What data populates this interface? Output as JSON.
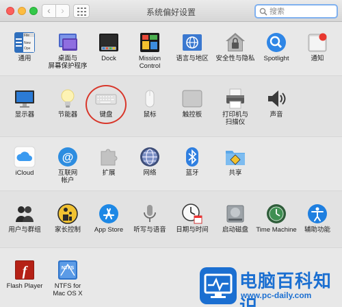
{
  "window": {
    "title": "系统偏好设置",
    "search_placeholder": "搜索",
    "back_glyph": "‹",
    "forward_glyph": "›"
  },
  "rows": [
    [
      {
        "id": "general",
        "label": "通用",
        "icon": "general-icon"
      },
      {
        "id": "desktop",
        "label": "桌面与\n屏幕保护程序",
        "icon": "desktop-screensaver-icon"
      },
      {
        "id": "dock",
        "label": "Dock",
        "icon": "dock-icon"
      },
      {
        "id": "mission-control",
        "label": "Mission\nControl",
        "icon": "mission-control-icon"
      },
      {
        "id": "language",
        "label": "语言与地区",
        "icon": "language-region-icon"
      },
      {
        "id": "security",
        "label": "安全性与隐私",
        "icon": "security-privacy-icon"
      },
      {
        "id": "spotlight",
        "label": "Spotlight",
        "icon": "spotlight-icon"
      },
      {
        "id": "notifications",
        "label": "通知",
        "icon": "notifications-icon"
      }
    ],
    [
      {
        "id": "displays",
        "label": "显示器",
        "icon": "display-icon"
      },
      {
        "id": "energy",
        "label": "节能器",
        "icon": "energy-saver-icon"
      },
      {
        "id": "keyboard",
        "label": "键盘",
        "icon": "keyboard-icon"
      },
      {
        "id": "mouse",
        "label": "鼠标",
        "icon": "mouse-icon"
      },
      {
        "id": "trackpad",
        "label": "触控板",
        "icon": "trackpad-icon"
      },
      {
        "id": "printers",
        "label": "打印机与\n扫描仪",
        "icon": "printer-icon"
      },
      {
        "id": "sound",
        "label": "声音",
        "icon": "speaker-icon"
      }
    ],
    [
      {
        "id": "icloud",
        "label": "iCloud",
        "icon": "icloud-icon"
      },
      {
        "id": "internet-accounts",
        "label": "互联网\n帐户",
        "icon": "internet-accounts-icon"
      },
      {
        "id": "extensions",
        "label": "扩展",
        "icon": "extensions-icon"
      },
      {
        "id": "network",
        "label": "网络",
        "icon": "network-icon"
      },
      {
        "id": "bluetooth",
        "label": "蓝牙",
        "icon": "bluetooth-icon"
      },
      {
        "id": "sharing",
        "label": "共享",
        "icon": "sharing-icon"
      }
    ],
    [
      {
        "id": "users",
        "label": "用户与群组",
        "icon": "users-groups-icon"
      },
      {
        "id": "parental",
        "label": "家长控制",
        "icon": "parental-controls-icon"
      },
      {
        "id": "app-store",
        "label": "App Store",
        "icon": "app-store-icon"
      },
      {
        "id": "dictation",
        "label": "听写与语音",
        "icon": "microphone-icon"
      },
      {
        "id": "date-time",
        "label": "日期与时间",
        "icon": "clock-icon"
      },
      {
        "id": "startup-disk",
        "label": "启动磁盘",
        "icon": "startup-disk-icon"
      },
      {
        "id": "time-machine",
        "label": "Time Machine",
        "icon": "time-machine-icon"
      },
      {
        "id": "accessibility",
        "label": "辅助功能",
        "icon": "accessibility-icon"
      }
    ],
    [
      {
        "id": "flash-player",
        "label": "Flash Player",
        "icon": "flash-player-icon"
      },
      {
        "id": "ntfs",
        "label": "NTFS for\nMac OS X",
        "icon": "ntfs-icon"
      }
    ]
  ],
  "general_icon_text": "File\nNew\nOpe",
  "ntfs_icon_text": "NTFS",
  "flash_icon_text": "f",
  "watermark": {
    "title": "电脑百科知识",
    "url": "www.pc-daily.com"
  },
  "colors": {
    "accent": "#1b6fd1",
    "highlight_circle": "#d8362a",
    "notification_badge": "#e8382f"
  }
}
